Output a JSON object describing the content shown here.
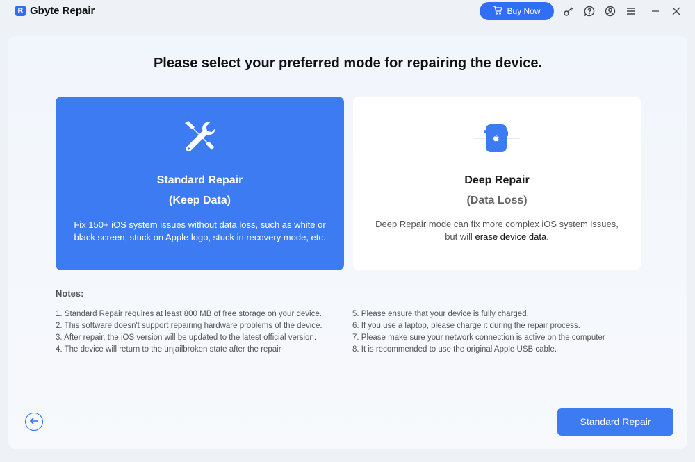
{
  "app": {
    "logo_letter": "R",
    "title": "Gbyte Repair",
    "buy_label": "Buy Now"
  },
  "colors": {
    "accent": "#3d7bf3",
    "buy": "#2f6ef5"
  },
  "icons": {
    "buy": "cart-icon",
    "key": "key-icon",
    "help": "help-icon",
    "account": "account-icon",
    "menu": "menu-icon",
    "minimize": "minimize-icon",
    "close": "close-icon",
    "tools": "tools-icon",
    "phone": "phone-icon",
    "back": "back-arrow-icon"
  },
  "main": {
    "heading": "Please select your preferred mode for repairing the device.",
    "standard": {
      "title": "Standard Repair",
      "subtitle": "(Keep Data)",
      "description": "Fix 150+ iOS system issues without data loss, such as white or black screen, stuck on Apple logo, stuck in recovery mode, etc."
    },
    "deep": {
      "title": "Deep Repair",
      "subtitle": "(Data Loss)",
      "description_1": "Deep Repair mode can fix more complex iOS system issues, but will ",
      "description_em": "erase device data",
      "description_2": "."
    },
    "notes_title": "Notes:",
    "notes_left": [
      "1. Standard Repair requires at least 800 MB of free storage on your device.",
      "2. This software doesn't support repairing hardware problems of the device.",
      "3. After repair, the iOS version will be updated to the latest official version.",
      "4. The device will return to the unjailbroken state after the repair"
    ],
    "notes_right": [
      "5. Please ensure that your device is fully charged.",
      "6. If you use a laptop, please charge it during the repair process.",
      "7. Please make sure your network connection is active on the computer",
      "8. It is recommended to use the original Apple USB cable."
    ],
    "primary_button": "Standard Repair"
  }
}
